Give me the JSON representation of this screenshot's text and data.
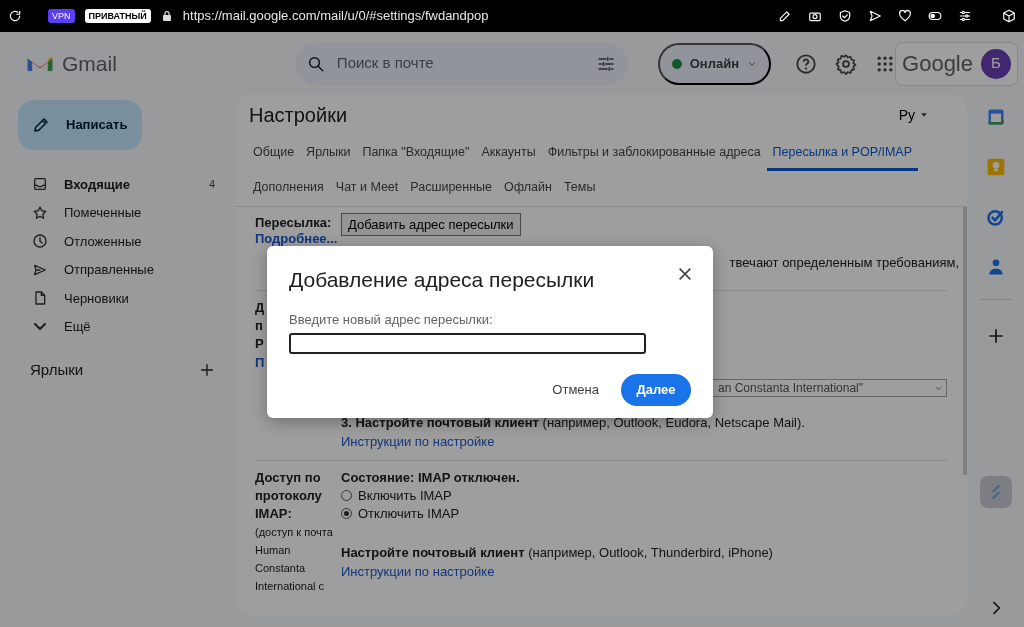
{
  "browser": {
    "vpn_badge": "VPN",
    "private_badge": "ПРИВАТНЫЙ",
    "url": "https://mail.google.com/mail/u/0/#settings/fwdandpop"
  },
  "header": {
    "app_name": "Gmail",
    "search": {
      "placeholder": "Поиск в почте"
    },
    "status": {
      "label": "Онлайн"
    },
    "account_brand": "Google",
    "avatar": "Б"
  },
  "sidebar": {
    "compose": "Написать",
    "items": [
      {
        "kind": "inbox",
        "label": "Входящие",
        "count": "4",
        "unread": true
      },
      {
        "kind": "starred",
        "label": "Помеченные",
        "unread": false
      },
      {
        "kind": "snoozed",
        "label": "Отложенные",
        "unread": false
      },
      {
        "kind": "sent",
        "label": "Отправленные",
        "unread": false
      },
      {
        "kind": "drafts",
        "label": "Черновики",
        "unread": false
      },
      {
        "kind": "more",
        "label": "Ещё",
        "unread": false
      }
    ],
    "labels_heading": "Ярлыки"
  },
  "settings": {
    "title": "Настройки",
    "language": "Ру",
    "tabs": [
      [
        {
          "label": "Общие",
          "selected": false
        },
        {
          "label": "Ярлыки",
          "selected": false
        },
        {
          "label": "Папка \"Входящие\"",
          "selected": false
        },
        {
          "label": "Аккаунты",
          "selected": false
        },
        {
          "label": "Фильтры и заблокированные адреса",
          "selected": false
        },
        {
          "label": "Пересылка и POP/IMAP",
          "selected": true
        }
      ],
      [
        {
          "label": "Дополнения",
          "selected": false
        },
        {
          "label": "Чат и Meet",
          "selected": false
        },
        {
          "label": "Расширенные",
          "selected": false
        },
        {
          "label": "Офлайн",
          "selected": false
        },
        {
          "label": "Темы",
          "selected": false
        }
      ]
    ],
    "forwarding": {
      "label": "Пересылка:",
      "button": "Добавить адрес пересылки",
      "link": "Подробнее...",
      "note": "твечают определенным требованиям,"
    },
    "pop": {
      "label_lines": [
        "Д",
        "п",
        "P"
      ],
      "link": "П",
      "select_value": "an Constanta International\"",
      "step": "**3. Настройте почтовый клиент** (например, Outlook, Eudora, Netscape Mail).",
      "step_link": "Инструкции по настройке"
    },
    "imap": {
      "label": "Доступ по протоколу IMAP:",
      "sublabel": "(доступ к почта Human Constanta International с",
      "status": "Состояние: IMAP отключен.",
      "options": [
        {
          "label": "Включить IMAP",
          "selected": false
        },
        {
          "label": "Отключить IMAP",
          "selected": true
        }
      ],
      "client": "**Настройте почтовый клиент** (например, Outlook, Thunderbird, iPhone)",
      "client_link": "Инструкции по настройке"
    }
  },
  "dialog": {
    "title": "Добавление адреса пересылки",
    "field_label": "Введите новый адрес пересылки:",
    "cancel": "Отмена",
    "next": "Далее"
  }
}
